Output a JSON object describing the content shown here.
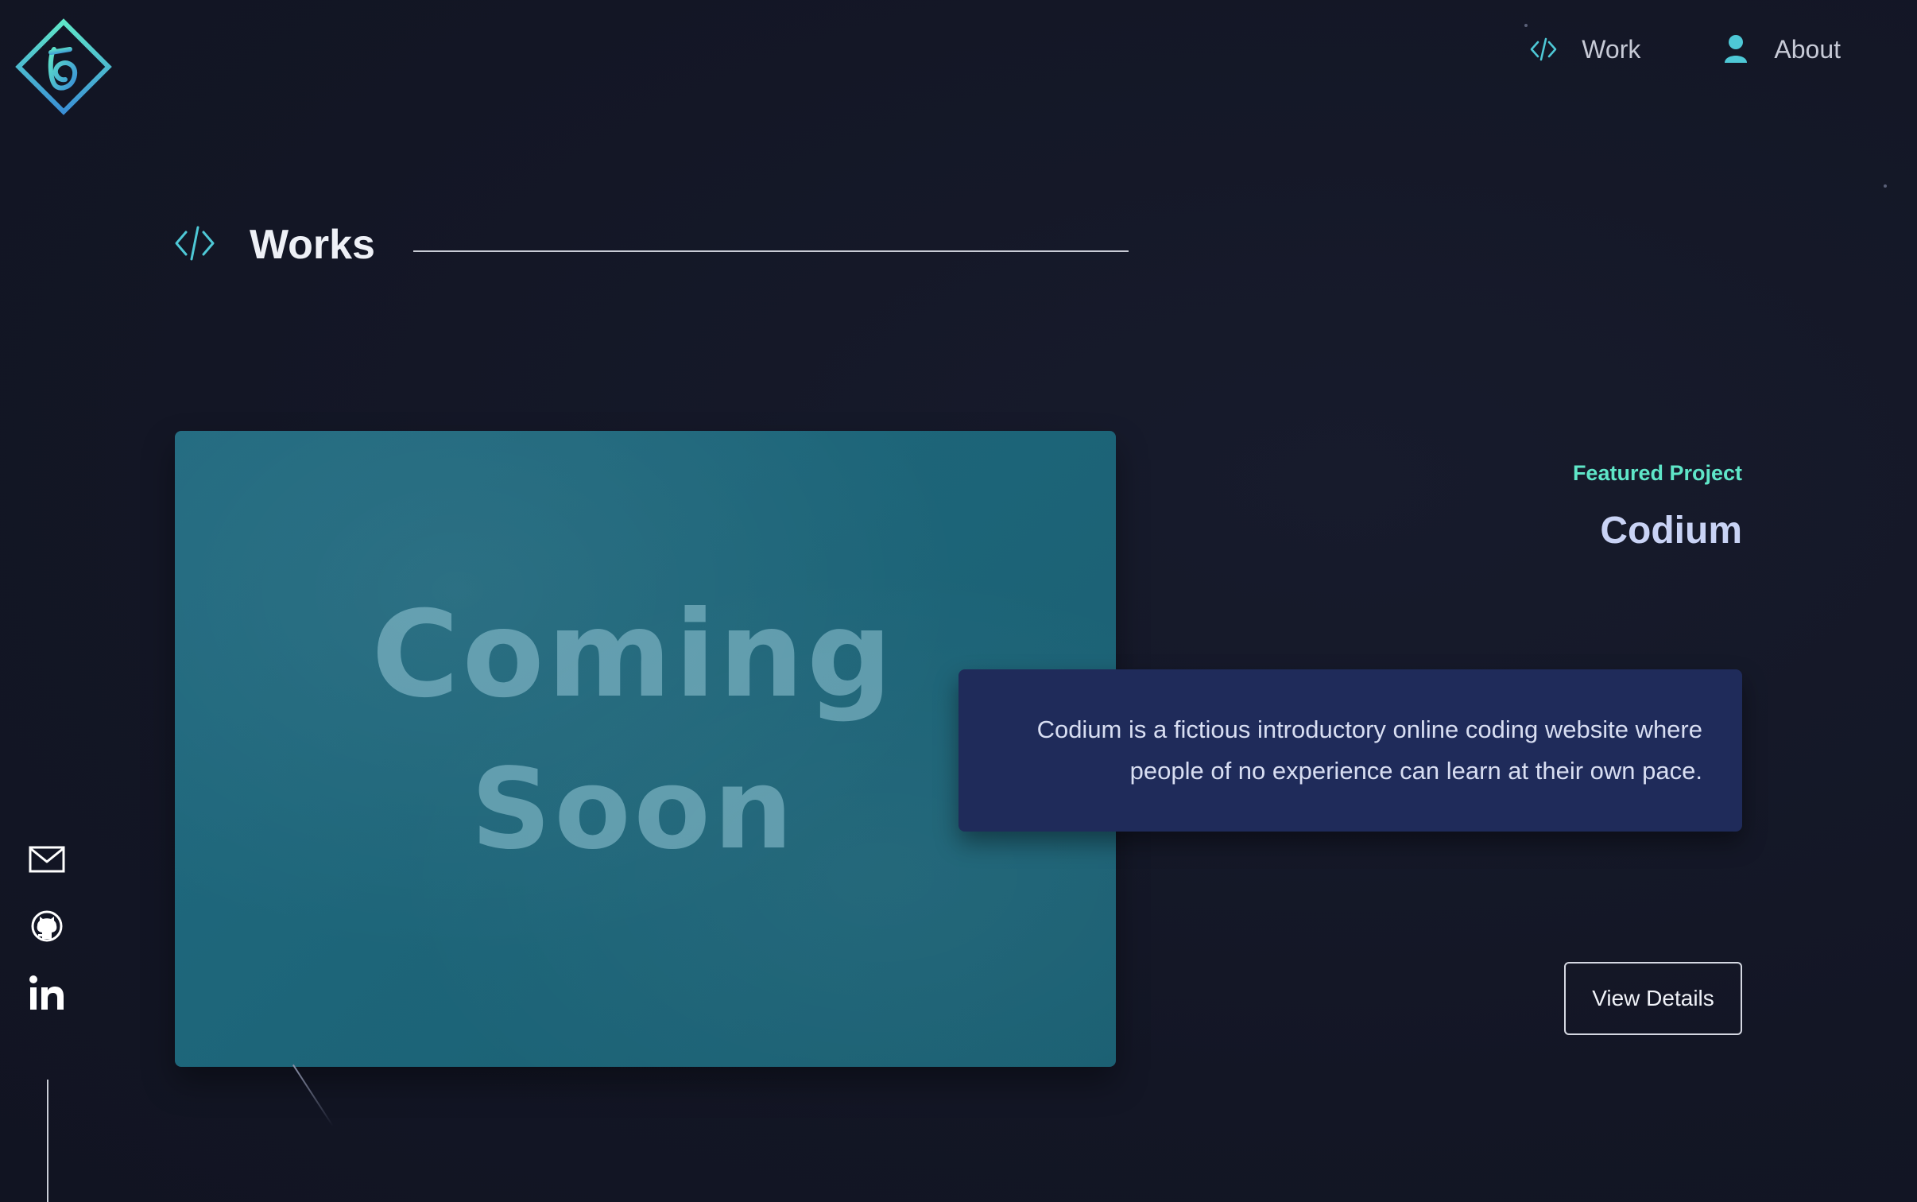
{
  "nav": {
    "items": [
      {
        "label": "Work",
        "icon": "code-icon"
      },
      {
        "label": "About",
        "icon": "user-icon"
      }
    ]
  },
  "section": {
    "title": "Works",
    "icon": "code-icon"
  },
  "project": {
    "image_text_line1": "Coming",
    "image_text_line2": "Soon",
    "featured_label": "Featured Project",
    "title": "Codium",
    "description_line1": "Codium is a fictious introductory online coding website where",
    "description_line2": "people of no experience can learn at their own pace.",
    "button_label": "View Details"
  },
  "social": {
    "items": [
      "mail-icon",
      "github-icon",
      "linkedin-icon"
    ]
  },
  "colors": {
    "background": "#141727",
    "accent": "#5fe6c8",
    "nav_icon": "#4ec8d6",
    "card": "#1f2b5a",
    "title": "#c9d3f5"
  }
}
